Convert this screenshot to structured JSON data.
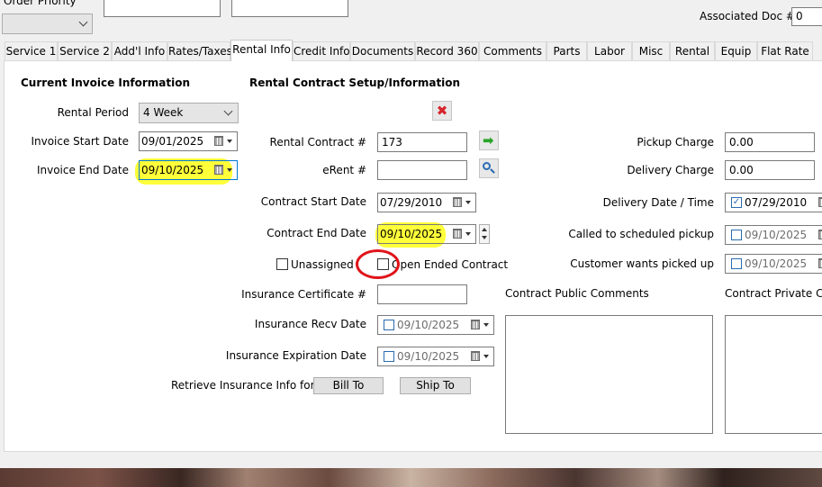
{
  "top": {
    "order_priority_label": "Order Priority",
    "associated_doc_label": "Associated Doc #",
    "associated_doc_value": "0"
  },
  "tabs": [
    "Service 1",
    "Service 2",
    "Add'l Info",
    "Rates/Taxes",
    "Rental Info",
    "Credit Info",
    "Documents",
    "Record 360",
    "Comments",
    "Parts",
    "Labor",
    "Misc",
    "Rental",
    "Equip",
    "Flat Rate"
  ],
  "active_tab": "Rental Info",
  "invoice": {
    "title": "Current Invoice Information",
    "rental_period_label": "Rental Period",
    "rental_period_value": "4 Week",
    "start_label": "Invoice Start Date",
    "start_value": "09/01/2025",
    "end_label": "Invoice End Date",
    "end_value": "09/10/2025"
  },
  "contract": {
    "title": "Rental Contract Setup/Information",
    "contract_no_label": "Rental Contract #",
    "contract_no_value": "173",
    "erent_label": "eRent #",
    "erent_value": "",
    "start_label": "Contract Start Date",
    "start_value": "07/29/2010",
    "end_label": "Contract End Date",
    "end_value": "09/10/2025",
    "unassigned_label": "Unassigned",
    "open_ended_label": "Open Ended Contract",
    "ins_cert_label": "Insurance Certificate #",
    "ins_cert_value": "",
    "ins_recv_label": "Insurance Recv Date",
    "ins_recv_value": "09/10/2025",
    "ins_exp_label": "Insurance Expiration Date",
    "ins_exp_value": "09/10/2025",
    "retrieve_label": "Retrieve Insurance Info for:",
    "bill_to_label": "Bill To",
    "ship_to_label": "Ship To",
    "public_comments_label": "Contract Public Comments",
    "private_comments_label": "Contract Private Comments"
  },
  "charges": {
    "pickup_label": "Pickup Charge",
    "pickup_value": "0.00",
    "delivery_label": "Delivery Charge",
    "delivery_value": "0.00",
    "delivery_dt_label": "Delivery Date / Time",
    "delivery_dt_value": "07/29/2010",
    "called_label": "Called to scheduled pickup",
    "called_value": "09/10/2025",
    "wants_label": "Customer wants picked up",
    "wants_value": "09/10/2025"
  },
  "colors": {
    "highlight": "#ffff3a",
    "annotation_circle": "#e0141a"
  }
}
